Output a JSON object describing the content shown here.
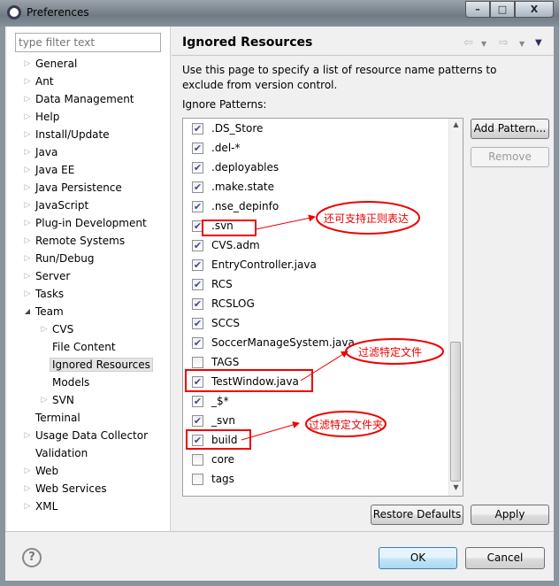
{
  "window": {
    "title": "Preferences",
    "minimize": "–",
    "maximize": "□",
    "close": "X"
  },
  "filter": {
    "placeholder": "type filter text"
  },
  "tree": [
    {
      "label": "General",
      "level": 0,
      "expandable": true
    },
    {
      "label": "Ant",
      "level": 0,
      "expandable": true
    },
    {
      "label": "Data Management",
      "level": 0,
      "expandable": true
    },
    {
      "label": "Help",
      "level": 0,
      "expandable": true
    },
    {
      "label": "Install/Update",
      "level": 0,
      "expandable": true
    },
    {
      "label": "Java",
      "level": 0,
      "expandable": true
    },
    {
      "label": "Java EE",
      "level": 0,
      "expandable": true
    },
    {
      "label": "Java Persistence",
      "level": 0,
      "expandable": true
    },
    {
      "label": "JavaScript",
      "level": 0,
      "expandable": true
    },
    {
      "label": "Plug-in Development",
      "level": 0,
      "expandable": true
    },
    {
      "label": "Remote Systems",
      "level": 0,
      "expandable": true
    },
    {
      "label": "Run/Debug",
      "level": 0,
      "expandable": true
    },
    {
      "label": "Server",
      "level": 0,
      "expandable": true
    },
    {
      "label": "Tasks",
      "level": 0,
      "expandable": true
    },
    {
      "label": "Team",
      "level": 0,
      "expandable": true,
      "expanded": true
    },
    {
      "label": "CVS",
      "level": 1,
      "expandable": true
    },
    {
      "label": "File Content",
      "level": 1,
      "expandable": false
    },
    {
      "label": "Ignored Resources",
      "level": 1,
      "expandable": false,
      "selected": true
    },
    {
      "label": "Models",
      "level": 1,
      "expandable": false
    },
    {
      "label": "SVN",
      "level": 1,
      "expandable": true
    },
    {
      "label": "Terminal",
      "level": 0,
      "expandable": false
    },
    {
      "label": "Usage Data Collector",
      "level": 0,
      "expandable": true
    },
    {
      "label": "Validation",
      "level": 0,
      "expandable": false
    },
    {
      "label": "Web",
      "level": 0,
      "expandable": true
    },
    {
      "label": "Web Services",
      "level": 0,
      "expandable": true
    },
    {
      "label": "XML",
      "level": 0,
      "expandable": true
    }
  ],
  "page": {
    "title": "Ignored Resources",
    "description": "Use this page to specify a list of resource name patterns to exclude from version control.",
    "patterns_label": "Ignore Patterns:"
  },
  "patterns": [
    {
      "name": ".DS_Store",
      "checked": true
    },
    {
      "name": ".del-*",
      "checked": true
    },
    {
      "name": ".deployables",
      "checked": true
    },
    {
      "name": ".make.state",
      "checked": true
    },
    {
      "name": ".nse_depinfo",
      "checked": true
    },
    {
      "name": ".svn",
      "checked": true
    },
    {
      "name": "CVS.adm",
      "checked": true
    },
    {
      "name": "EntryController.java",
      "checked": true
    },
    {
      "name": "RCS",
      "checked": true
    },
    {
      "name": "RCSLOG",
      "checked": true
    },
    {
      "name": "SCCS",
      "checked": true
    },
    {
      "name": "SoccerManageSystem.java",
      "checked": true
    },
    {
      "name": "TAGS",
      "checked": false
    },
    {
      "name": "TestWindow.java",
      "checked": true
    },
    {
      "name": "_$*",
      "checked": true
    },
    {
      "name": "_svn",
      "checked": true
    },
    {
      "name": "build",
      "checked": true
    },
    {
      "name": "core",
      "checked": false
    },
    {
      "name": "tags",
      "checked": false
    }
  ],
  "buttons": {
    "add_pattern": "Add Pattern...",
    "remove": "Remove",
    "restore_defaults": "Restore Defaults",
    "apply": "Apply",
    "ok": "OK",
    "cancel": "Cancel",
    "help": "?"
  },
  "annotations": {
    "regex_note": "还可支持正则表达",
    "file_note": "过滤特定文件",
    "folder_note": "过滤特定文件夹",
    "color": "#e00000"
  }
}
